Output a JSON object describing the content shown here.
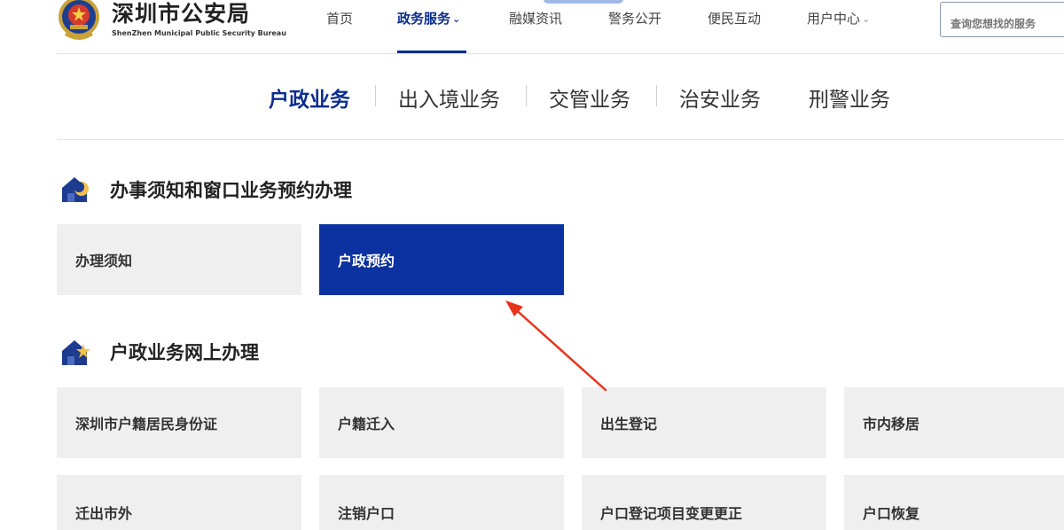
{
  "header": {
    "title": "深圳市公安局",
    "subtitle": "ShenZhen Municipal Public Security Bureau",
    "nav": [
      {
        "label": "首页"
      },
      {
        "label": "政务服务",
        "chevron": "⌄"
      },
      {
        "label": "融媒资讯"
      },
      {
        "label": "警务公开"
      },
      {
        "label": "便民互动"
      },
      {
        "label": "用户中心",
        "chevron": "⌄"
      }
    ],
    "search_placeholder": "查询您想找的服务"
  },
  "categories": [
    {
      "label": "户政业务"
    },
    {
      "label": "出入境业务"
    },
    {
      "label": "交管业务"
    },
    {
      "label": "治安业务"
    },
    {
      "label": "刑警业务"
    }
  ],
  "sections": [
    {
      "title": "办事须知和窗口业务预约办理",
      "icon": "house-moon-icon",
      "tiles": [
        {
          "label": "办理须知"
        },
        {
          "label": "户政预约"
        }
      ]
    },
    {
      "title": "户政业务网上办理",
      "icon": "house-star-icon",
      "tiles": [
        {
          "label": "深圳市户籍居民身份证"
        },
        {
          "label": "户籍迁入"
        },
        {
          "label": "出生登记"
        },
        {
          "label": "市内移居"
        },
        {
          "label": "迁出市外"
        },
        {
          "label": "注销户口"
        },
        {
          "label": "户口登记项目变更更正"
        },
        {
          "label": "户口恢复"
        }
      ]
    }
  ],
  "colors": {
    "accent": "#0b2c8f",
    "selected_tile": "#0b32a0",
    "tile_bg": "#efefef",
    "annotation_arrow": "#e8341c"
  },
  "selected_tile": "户政预约",
  "active_nav": "政务服务",
  "active_category": "户政业务"
}
